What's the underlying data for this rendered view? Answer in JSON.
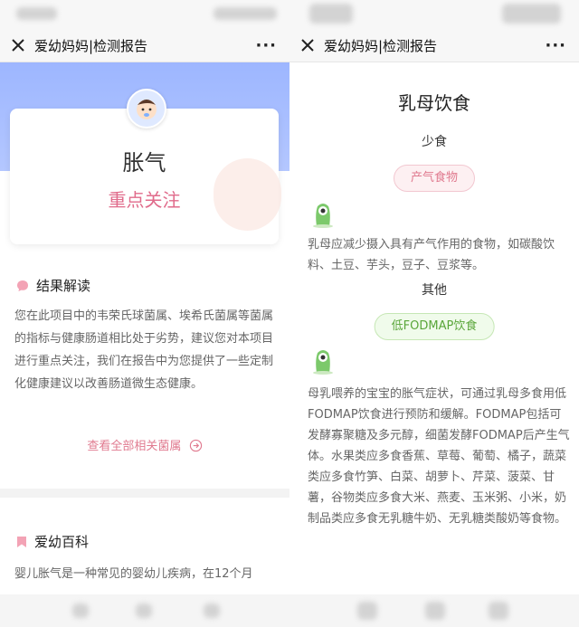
{
  "nav": {
    "title": "爱幼妈妈|检测报告",
    "more": "···"
  },
  "left": {
    "card": {
      "title": "胀气",
      "status": "重点关注"
    },
    "result": {
      "heading": "结果解读",
      "text": "您在此项目中的韦荣氏球菌属、埃希氏菌属等菌属的指标与健康肠道相比处于劣势，建议您对本项目进行重点关注，我们在报告中为您提供了一些定制化健康建议以改善肠道微生态健康。",
      "link": "查看全部相关菌属"
    },
    "encyclopedia": {
      "heading": "爱幼百科",
      "text": "婴儿胀气是一种常见的婴幼儿疾病，在12个月"
    }
  },
  "right": {
    "title": "乳母饮食",
    "section1": {
      "label": "少食",
      "tag": "产气食物",
      "text": "乳母应减少摄入具有产气作用的食物，如碳酸饮料、土豆、芋头，豆子、豆浆等。"
    },
    "section2": {
      "label": "其他",
      "tag": "低FODMAP饮食",
      "text": "母乳喂养的宝宝的胀气症状，可通过乳母多食用低FODMAP饮食进行预防和缓解。FODMAP包括可发酵寡聚糖及多元醇，细菌发酵FODMAP后产生气体。水果类应多食香蕉、草莓、葡萄、橘子，蔬菜类应多食竹笋、白菜、胡萝卜、芹菜、菠菜、甘薯，谷物类应多食大米、燕麦、玉米粥、小米，奶制品类应多食无乳糖牛奶、无乳糖类酸奶等食物。"
    }
  },
  "colors": {
    "accent_pink": "#e06b8b",
    "accent_green": "#5aa63a",
    "hero_blue": "#9db6ff"
  }
}
